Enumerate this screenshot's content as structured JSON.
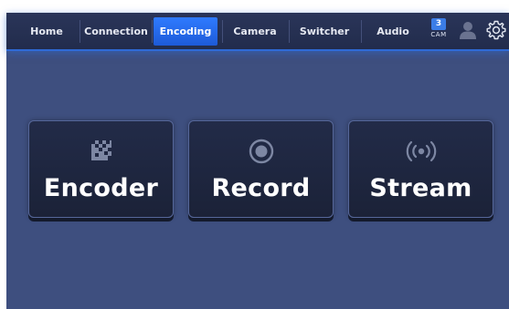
{
  "nav": {
    "tabs": [
      {
        "label": "Home"
      },
      {
        "label": "Connection"
      },
      {
        "label": "Encoding",
        "active": true
      },
      {
        "label": "Camera"
      },
      {
        "label": "Switcher"
      },
      {
        "label": "Audio"
      }
    ],
    "cam_count": "3",
    "cam_label": "CAM"
  },
  "main": {
    "buttons": [
      {
        "label": "Encoder",
        "icon": "encoder-icon"
      },
      {
        "label": "Record",
        "icon": "record-icon"
      },
      {
        "label": "Stream",
        "icon": "stream-icon"
      }
    ]
  },
  "colors": {
    "background": "#3e4f7f",
    "navbar": "#252f50",
    "accent": "#2f7bff",
    "button": "#1e2640"
  }
}
